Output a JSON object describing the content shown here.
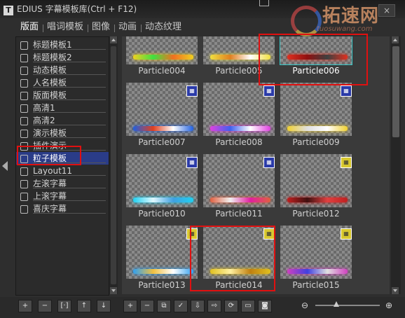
{
  "window": {
    "title": "EDIUS 字幕模板库(Ctrl + F12)",
    "app_icon": "T",
    "close_label": "×"
  },
  "watermark": {
    "main": "拓速网",
    "sub": "tuosuwang.com"
  },
  "tabs": [
    {
      "label": "版面",
      "active": true
    },
    {
      "label": "唱词模板",
      "active": false
    },
    {
      "label": "图像",
      "active": false
    },
    {
      "label": "动画",
      "active": false
    },
    {
      "label": "动态纹理",
      "active": false
    }
  ],
  "template_list": [
    {
      "label": "标题模板1"
    },
    {
      "label": "标题模板2"
    },
    {
      "label": "动态模板"
    },
    {
      "label": "人名模板"
    },
    {
      "label": "版面模板"
    },
    {
      "label": "高清1"
    },
    {
      "label": "高清2"
    },
    {
      "label": "演示模板"
    },
    {
      "label": "插件演示"
    },
    {
      "label": "粒子模板",
      "selected": true
    },
    {
      "label": "Layout11"
    },
    {
      "label": "左滚字幕"
    },
    {
      "label": "上滚字幕"
    },
    {
      "label": "喜庆字幕"
    }
  ],
  "thumbnails": [
    {
      "name": "Particle004",
      "badge": "",
      "colors": [
        "#f0d020",
        "#40e040",
        "#f07020"
      ]
    },
    {
      "name": "Particle005",
      "badge": "",
      "colors": [
        "#f0e040",
        "#e08020",
        "#ffffff"
      ]
    },
    {
      "name": "Particle006",
      "badge": "",
      "colors": [
        "#e03020",
        "#901010",
        "#404040"
      ],
      "highlight": true
    },
    {
      "name": "Particle007",
      "badge": "blue",
      "colors": [
        "#2060e0",
        "#e04020",
        "#ffffff"
      ]
    },
    {
      "name": "Particle008",
      "badge": "blue",
      "colors": [
        "#e040e0",
        "#4060f0",
        "#ffffff"
      ]
    },
    {
      "name": "Particle009",
      "badge": "blue",
      "colors": [
        "#f0d030",
        "#e0e0e0",
        "#ffffff"
      ]
    },
    {
      "name": "Particle010",
      "badge": "blue",
      "colors": [
        "#20d0f0",
        "#e0f8ff",
        "#40a0e0"
      ]
    },
    {
      "name": "Particle011",
      "badge": "blue",
      "colors": [
        "#e06040",
        "#f0f0f0",
        "#e020a0"
      ]
    },
    {
      "name": "Particle012",
      "badge": "yellow",
      "colors": [
        "#c02020",
        "#401010",
        "#e04040"
      ]
    },
    {
      "name": "Particle013",
      "badge": "yellow",
      "colors": [
        "#30a0f0",
        "#f0c040",
        "#ffffff"
      ]
    },
    {
      "name": "Particle014",
      "badge": "yellow",
      "colors": [
        "#e0c020",
        "#fff0a0",
        "#c08010"
      ]
    },
    {
      "name": "Particle015",
      "badge": "yellow",
      "colors": [
        "#d040c0",
        "#4040e0",
        "#e0e0e0"
      ]
    }
  ],
  "bottom_toolbar": {
    "left_buttons": [
      {
        "icon": "add-category-icon",
        "glyph": "+"
      },
      {
        "icon": "remove-category-icon",
        "glyph": "−"
      },
      {
        "icon": "rename-category-icon",
        "glyph": "[·]"
      },
      {
        "icon": "move-up-icon",
        "glyph": "↑"
      },
      {
        "icon": "move-down-icon",
        "glyph": "↓"
      }
    ],
    "right_buttons": [
      {
        "icon": "add-template-icon",
        "glyph": "+"
      },
      {
        "icon": "remove-template-icon",
        "glyph": "−"
      },
      {
        "icon": "copy-template-icon",
        "glyph": "⧉"
      },
      {
        "icon": "apply-check-icon",
        "glyph": "✓"
      },
      {
        "icon": "import-icon",
        "glyph": "⇩"
      },
      {
        "icon": "export-icon",
        "glyph": "⇨"
      },
      {
        "icon": "refresh-icon",
        "glyph": "⟳"
      },
      {
        "icon": "preview-monitor-icon",
        "glyph": "▭"
      },
      {
        "icon": "snapshot-icon",
        "glyph": "◙"
      }
    ],
    "zoom_out_glyph": "⊖",
    "zoom_in_glyph": "⊕",
    "zoom_level": 0.33
  },
  "colors": {
    "selection": "#2a3c88",
    "annotation": "#e01010",
    "highlight_outline": "#38c8c8"
  }
}
